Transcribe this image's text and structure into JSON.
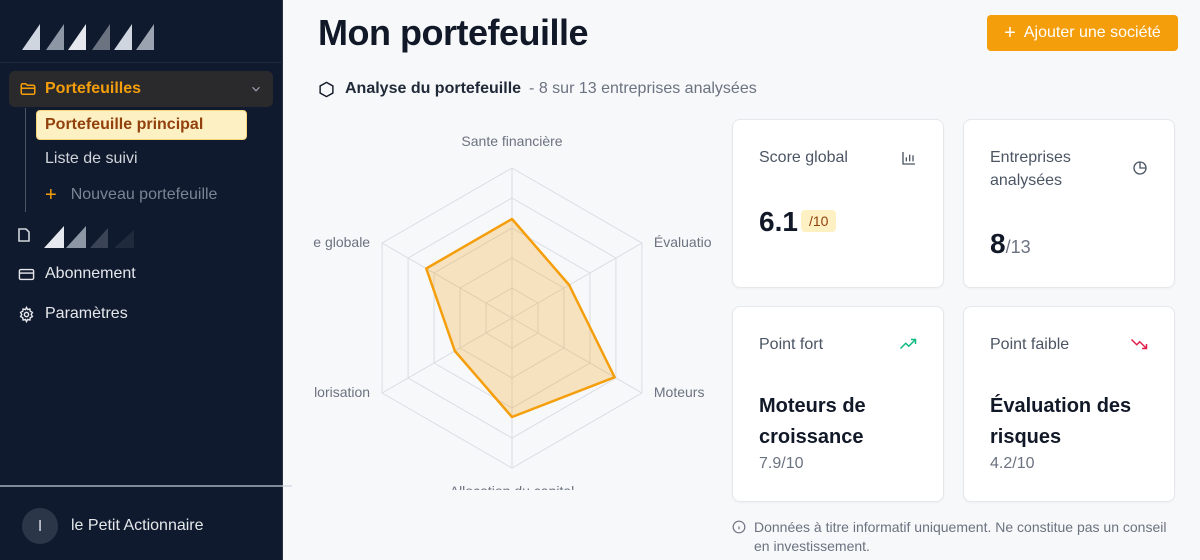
{
  "sidebar": {
    "group_label": "Portefeuilles",
    "sub_items": [
      "Portefeuille principal",
      "Liste de suivi"
    ],
    "new_portfolio": "Nouveau portefeuille",
    "nav": [
      "Abonnement",
      "Paramètres"
    ],
    "user": {
      "initial": "l",
      "name": "le Petit Actionnaire"
    }
  },
  "header": {
    "title": "Mon portefeuille",
    "add_button": "Ajouter une société"
  },
  "analysis": {
    "title": "Analyse du portefeuille",
    "subtitle": "- 8 sur 13 entreprises analysées"
  },
  "chart_data": {
    "type": "radar",
    "categories": [
      "Sante financière",
      "Évaluatio",
      "Moteurs",
      "Allocation du capital",
      "lorisation",
      "e globale"
    ],
    "values": [
      6.6,
      4.4,
      7.9,
      6.6,
      4.4,
      6.6
    ],
    "rlim": [
      0,
      10
    ],
    "grid": true,
    "color": "#f59e0b"
  },
  "cards": {
    "score": {
      "title": "Score global",
      "value": "6.1",
      "badge": "/10"
    },
    "analyzed": {
      "title_line1": "Entreprises",
      "title_line2": "analysées",
      "value": "8",
      "denominator": "/13"
    },
    "strong": {
      "title": "Point fort",
      "name_line1": "Moteurs de",
      "name_line2": "croissance",
      "score": "7.9/10",
      "color": "#10b981"
    },
    "weak": {
      "title": "Point faible",
      "name_line1": "Évaluation des",
      "name_line2": "risques",
      "score": "4.2/10",
      "color": "#e11d48"
    }
  },
  "disclaimer": {
    "line1": "Données à titre informatif uniquement. Ne constitue pas un conseil",
    "line2": "en investissement."
  }
}
